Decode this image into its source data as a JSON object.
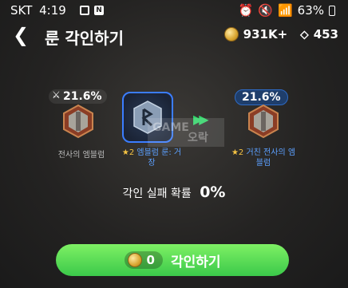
{
  "status_bar": {
    "carrier": "SKT",
    "time": "4:19",
    "battery": "63%"
  },
  "header": {
    "back_icon": "chevron-left-icon",
    "title": "룬 각인하기",
    "coins": "931K+",
    "gems": "453"
  },
  "source_item": {
    "percent": "21.6%",
    "name": "전사의 엠블럼"
  },
  "rune_item": {
    "stars": "★2",
    "name": "엠블럼 룬: 거장"
  },
  "result_item": {
    "percent": "21.6%",
    "stars": "★2",
    "name": "거친 전사의 엠블럼"
  },
  "watermark": {
    "line1": "GAME",
    "line2": "오락"
  },
  "fail_rate": {
    "label": "각인 실패 확률",
    "value": "0%"
  },
  "action": {
    "cost": "0",
    "label": "각인하기"
  },
  "colors": {
    "button": "#4fd653",
    "highlight": "#3b7dff"
  }
}
